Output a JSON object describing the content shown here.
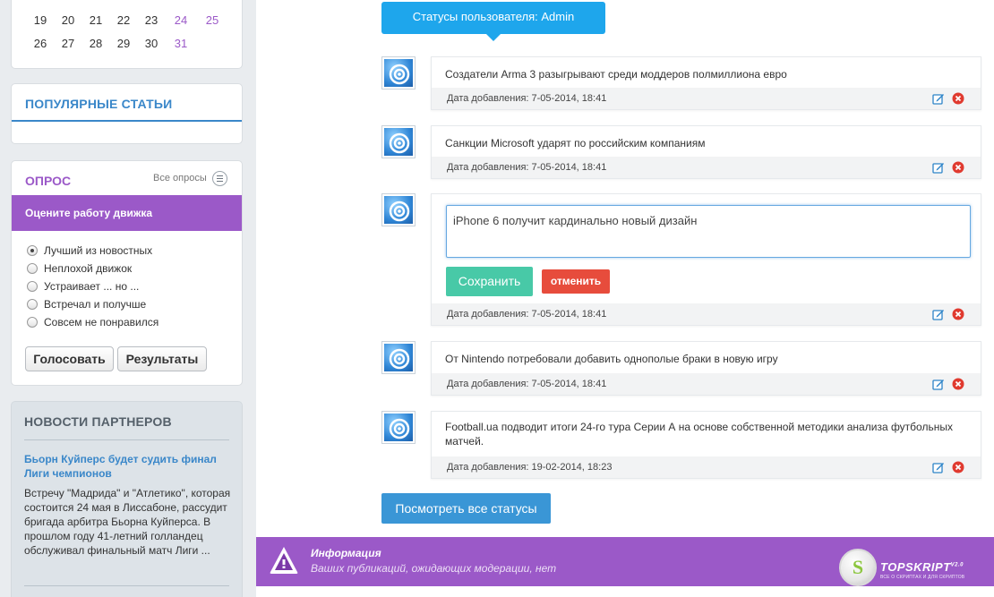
{
  "calendar": {
    "rows": [
      [
        {
          "d": "19",
          "we": false
        },
        {
          "d": "20",
          "we": false
        },
        {
          "d": "21",
          "we": false
        },
        {
          "d": "22",
          "we": false
        },
        {
          "d": "23",
          "we": false
        },
        {
          "d": "24",
          "we": true
        },
        {
          "d": "25",
          "we": true
        }
      ],
      [
        {
          "d": "26",
          "we": false
        },
        {
          "d": "27",
          "we": false
        },
        {
          "d": "28",
          "we": false
        },
        {
          "d": "29",
          "we": false
        },
        {
          "d": "30",
          "we": false
        },
        {
          "d": "31",
          "we": true
        }
      ]
    ]
  },
  "popular": {
    "title": "ПОПУЛЯРНЫЕ СТАТЬИ"
  },
  "poll": {
    "title": "ОПРОС",
    "all_link": "Все опросы",
    "question": "Оцените работу движка",
    "options": [
      {
        "label": "Лучший из новостных",
        "checked": true
      },
      {
        "label": "Неплохой движок",
        "checked": false
      },
      {
        "label": "Устраивает ... но ...",
        "checked": false
      },
      {
        "label": "Встречал и получше",
        "checked": false
      },
      {
        "label": "Совсем не понравился",
        "checked": false
      }
    ],
    "vote_label": "Голосовать",
    "results_label": "Результаты"
  },
  "partners": {
    "title": "НОВОСТИ ПАРТНЕРОВ",
    "headline": "Бьорн Куйперс будет судить финал Лиги чемпионов",
    "text": "Встречу \"Мадрида\" и \"Атлетико\", которая состоится 24 мая в Лиссабоне, рассудит бригада арбитра Бьорна Куйперса. В прошлом году 41-летний голландец обслуживал финальный матч Лиги ..."
  },
  "statuses": {
    "header": "Статусы пользователя: Admin",
    "items": [
      {
        "text": "Создатели Arma 3 разыгрывают среди моддеров полмиллиона евро",
        "date": "Дата добавления: 7-05-2014, 18:41"
      },
      {
        "text": "Санкции Microsoft ударят по российским компаниям",
        "date": "Дата добавления: 7-05-2014, 18:41"
      },
      {
        "text": "iPhone 6 получит кардинально новый дизайн",
        "date": "Дата добавления: 7-05-2014, 18:41",
        "editing": true
      },
      {
        "text": "От Nintendo потребовали добавить однополые браки в новую игру",
        "date": "Дата добавления: 7-05-2014, 18:41"
      },
      {
        "text": "Football.ua подводит итоги 24-го тура Серии А на основе собственной методики анализа футбольных матчей.",
        "date": "Дата добавления: 19-02-2014, 18:23"
      }
    ],
    "save_label": "Сохранить",
    "cancel_label": "отменить",
    "view_all_label": "Посмотреть все статусы"
  },
  "info": {
    "title": "Информация",
    "text": "Ваших публикаций, ожидающих модерации, нет"
  },
  "logo": {
    "letter": "S",
    "name": "TOPSKRIPT",
    "version": "V2.0",
    "tagline": "ВСЕ О СКРИПТАХ И ДЛЯ СКРИПТОВ"
  },
  "colors": {
    "accent_blue": "#1ea6ec",
    "purple": "#9b59c8",
    "save_green": "#48c9a7",
    "cancel_red": "#e74c3c"
  }
}
